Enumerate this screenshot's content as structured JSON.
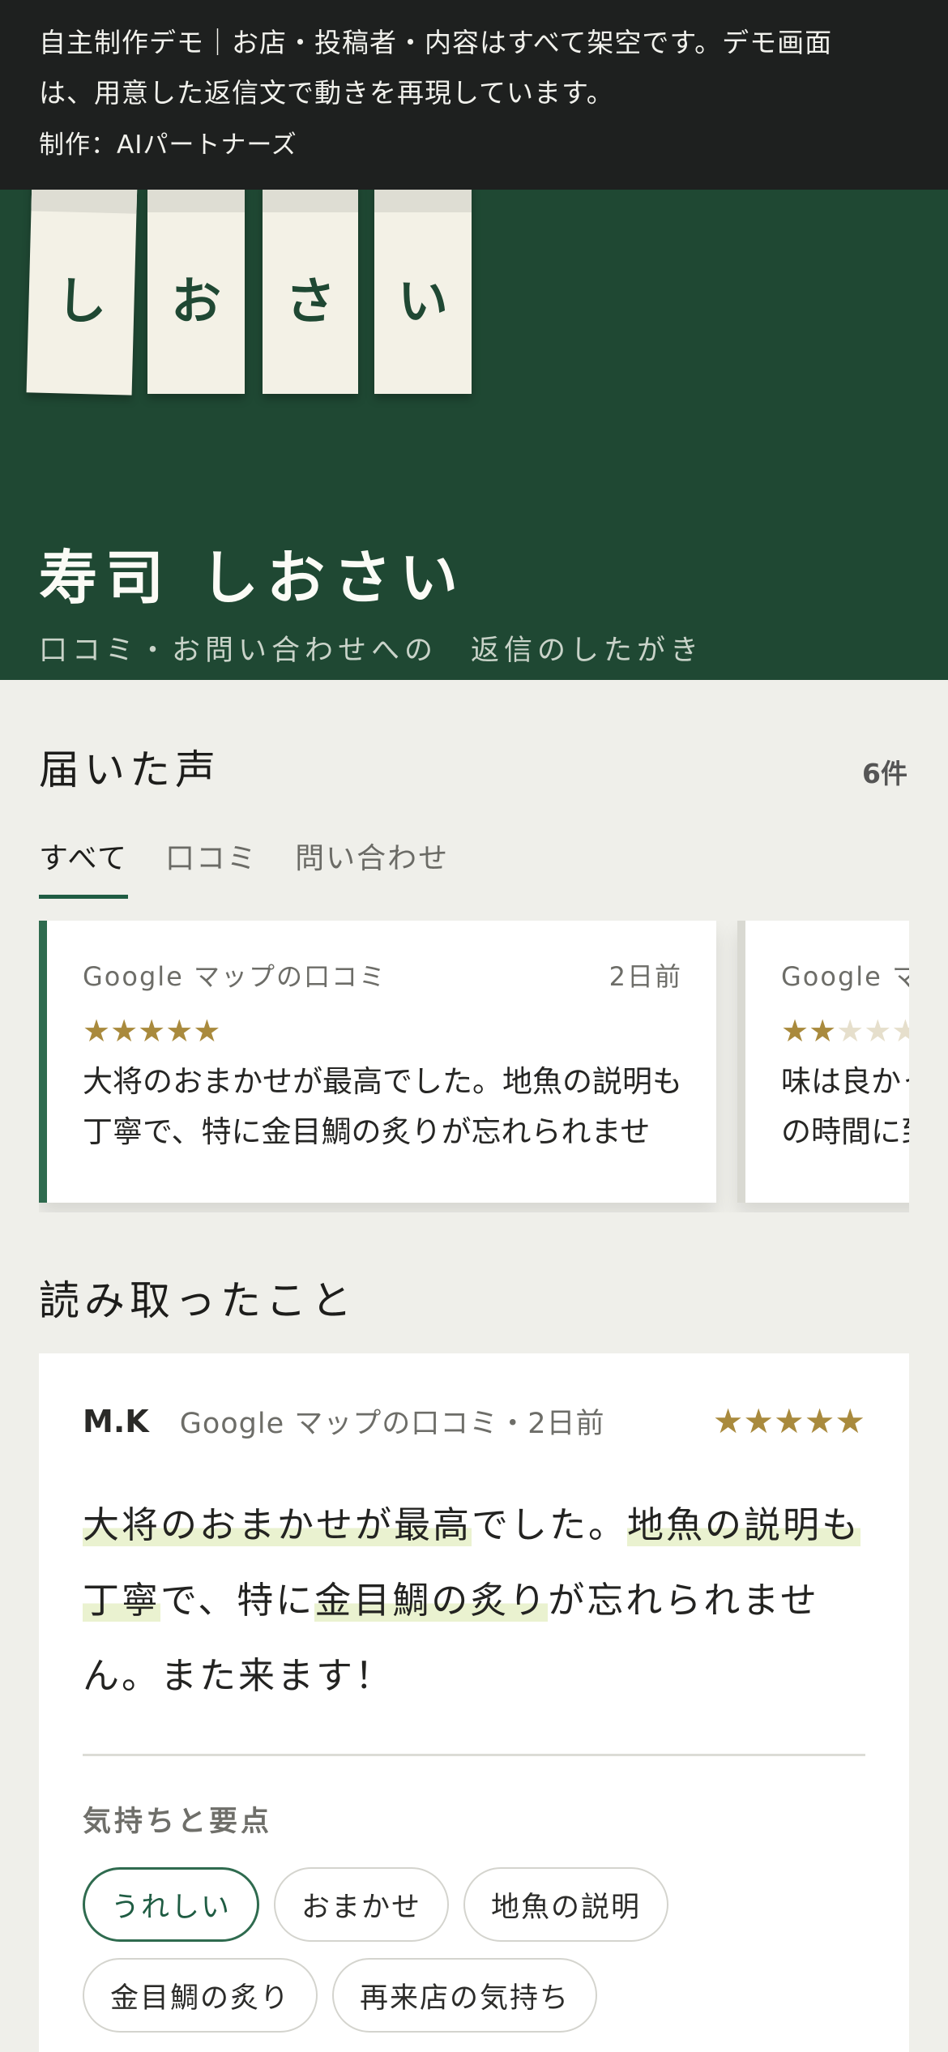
{
  "notice": {
    "line1": "自主制作デモ｜お店・投稿者・内容はすべて架空です。デモ画面",
    "line2": "は、用意した返信文で動きを再現しています。",
    "credit": "制作：AIパートナーズ"
  },
  "hero": {
    "noren": [
      "し",
      "お",
      "さ",
      "い"
    ],
    "title": "寿司 しおさい",
    "subtitle": "口コミ・お問い合わせへの　返信のしたがき"
  },
  "inbox": {
    "heading": "届いた声",
    "count": "6件",
    "tabs": [
      "すべて",
      "口コミ",
      "問い合わせ"
    ],
    "cards": [
      {
        "source": "Google マップの口コミ",
        "time": "2日前",
        "rating": 5,
        "text": "大将のおまかせが最高でした。地魚の説明も丁寧で、特に金目鯛の炙りが忘れられませ"
      },
      {
        "source": "Google マップの口コミ",
        "time": "",
        "rating": 2,
        "text": "味は良かったのですが、予約の時間に到着してから長い時間待たされた"
      }
    ]
  },
  "analysis": {
    "heading": "読み取ったこと",
    "author": "M.K",
    "meta": "Google マップの口コミ・2日前",
    "stars": "★★★★★",
    "review": [
      {
        "t": "大将のおまかせが最高",
        "hl": true
      },
      {
        "t": "でした。",
        "hl": false
      },
      {
        "t": "地魚の説明も丁寧",
        "hl": true
      },
      {
        "t": "で、特に",
        "hl": false
      },
      {
        "t": "金目鯛の炙り",
        "hl": true
      },
      {
        "t": "が忘れられません。また来ます！",
        "hl": false
      }
    ],
    "points_heading": "気持ちと要点",
    "feeling_chip": "うれしい",
    "chips": [
      "おまかせ",
      "地魚の説明",
      "金目鯛の炙り",
      "再来店の気持ち"
    ]
  },
  "colors": {
    "brand_green": "#1f4833",
    "accent_green": "#2f6b4f",
    "star_gold": "#a98a3d"
  }
}
